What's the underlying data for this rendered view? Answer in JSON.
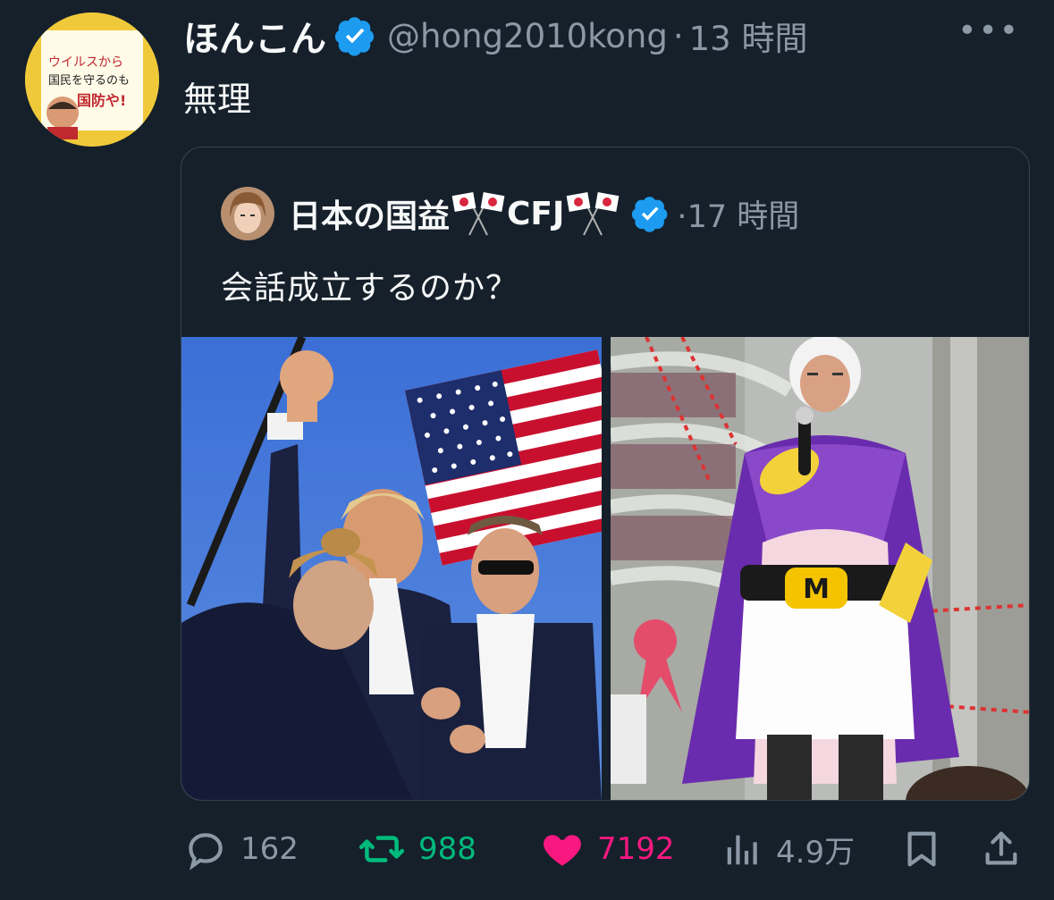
{
  "colors": {
    "background": "#15202b",
    "text": "#f7f9f9",
    "muted": "#8b98a5",
    "verified": "#1d9bf0",
    "retweet": "#00ba7c",
    "like": "#f91880",
    "border": "#38444d"
  },
  "post": {
    "author_name": "ほんこん",
    "handle": "@hong2010kong",
    "separator": "·",
    "time": "13 時間",
    "more_icon": "more-horizontal-icon",
    "text": "無理"
  },
  "avatar_book": {
    "line1": "ウイルスから",
    "line2": "国民を守るのも",
    "line3": "国防や!"
  },
  "quote": {
    "author_name_a": "日本の国益",
    "author_name_b": "CFJ",
    "separator": "·",
    "time": "17 時間",
    "text": "会話成立するのか？",
    "belt_letter": "M"
  },
  "actions": {
    "replies": "162",
    "retweets": "988",
    "likes": "7192",
    "views": "4.9万"
  }
}
